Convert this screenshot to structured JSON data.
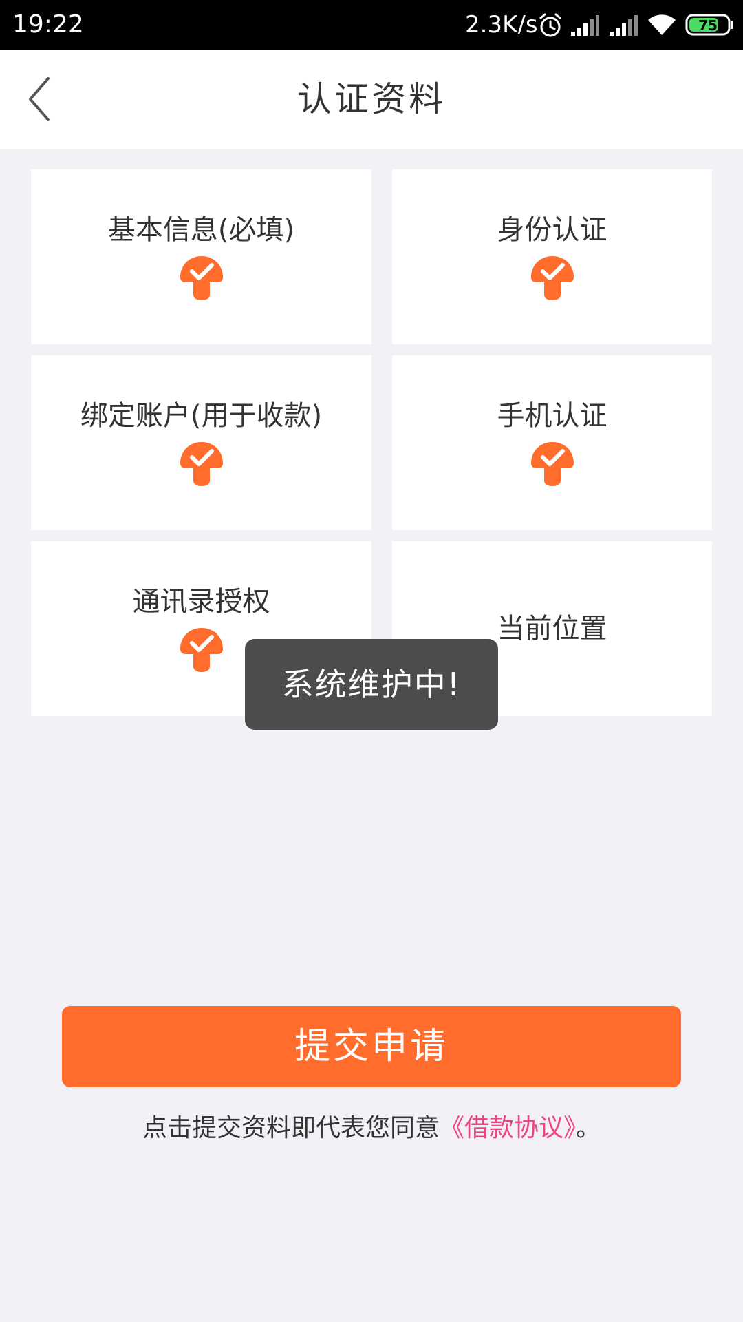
{
  "status_bar": {
    "time": "19:22",
    "net_speed": "2.3K/s",
    "battery_level": "75",
    "icons": [
      "alarm-icon",
      "signal-icon",
      "signal-icon",
      "wifi-icon",
      "battery-icon"
    ]
  },
  "header": {
    "title": "认证资料",
    "back_icon": "chevron-left-icon"
  },
  "items": [
    {
      "label": "基本信息(必填)",
      "status": "completed"
    },
    {
      "label": "身份认证",
      "status": "completed"
    },
    {
      "label": "绑定账户(用于收款)",
      "status": "completed"
    },
    {
      "label": "手机认证",
      "status": "completed"
    },
    {
      "label": "通讯录授权",
      "status": "completed"
    },
    {
      "label": "当前位置",
      "status": "incomplete"
    }
  ],
  "toast": {
    "message": "系统维护中!"
  },
  "footer": {
    "submit_label": "提交申请",
    "agreement_text": "点击提交资料即代表您同意",
    "agreement_link": "《借款协议》",
    "agreement_suffix": "。"
  },
  "colors": {
    "accent": "#ff6c2c",
    "check_badge": "#ff6c2c",
    "link": "#e8467c",
    "background": "#f3f0f6",
    "toast_bg": "#4c4c4c"
  }
}
